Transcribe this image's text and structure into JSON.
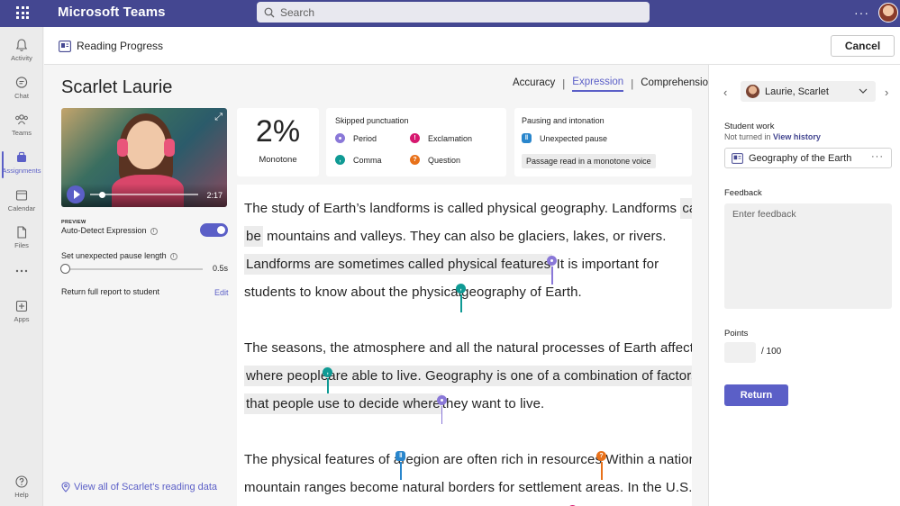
{
  "app": {
    "title": "Microsoft Teams",
    "search_placeholder": "Search",
    "more": "···"
  },
  "rail": [
    {
      "label": "Activity",
      "icon": "bell-icon"
    },
    {
      "label": "Chat",
      "icon": "chat-icon"
    },
    {
      "label": "Teams",
      "icon": "teams-icon"
    },
    {
      "label": "Assignments",
      "icon": "assignments-icon",
      "active": true
    },
    {
      "label": "Calendar",
      "icon": "calendar-icon"
    },
    {
      "label": "Files",
      "icon": "file-icon"
    },
    {
      "label": "",
      "icon": "more-icon"
    },
    {
      "label": "Apps",
      "icon": "apps-icon"
    },
    {
      "label": "Help",
      "icon": "help-icon"
    }
  ],
  "header": {
    "title": "Reading Progress",
    "cancel_label": "Cancel"
  },
  "student": {
    "name": "Scarlet Laurie",
    "video_time": "2:17"
  },
  "settings": {
    "preview_tag": "PREVIEW",
    "auto_detect_label": "Auto-Detect Expression",
    "auto_detect_on": true,
    "pause_length_label": "Set unexpected pause length",
    "pause_length_value": "0.5s",
    "full_report_label": "Return full report to student",
    "edit_label": "Edit",
    "view_all_label": "View all of Scarlet's reading data"
  },
  "tabs": {
    "items": [
      "Accuracy",
      "Expression",
      "Comprehension"
    ],
    "separator": "|",
    "active": "Expression"
  },
  "metrics": {
    "monotone_pct": "2%",
    "monotone_label": "Monotone",
    "skipped_title": "Skipped punctuation",
    "period": "Period",
    "exclamation": "Exclamation",
    "comma": "Comma",
    "question": "Question",
    "pausing_title": "Pausing and intonation",
    "unexpected_pause": "Unexpected pause",
    "monotone_chip": "Passage read in a monotone voice",
    "exclamation_mark": "!",
    "question_mark": "?"
  },
  "passage": {
    "l1a": "The study of Earth’s ",
    "l1b": "landforms",
    "l1c": " is called physical geography. Landforms ",
    "l1d": "can",
    "l2a": "be",
    "l2b": " mountains and valleys. They can also be ",
    "l2c": "glaciers",
    "l2d": ", lakes, or rivers.",
    "l3a": "Landforms are sometimes called physical features",
    "l3b": " It is important for",
    "l4a": "students to know about the physical",
    "l4b": "geography of Earth.",
    "l5a": "The seasons, the ",
    "l5b": "atmosphere",
    "l5c": " and all ",
    "l5d": "the",
    "l5e": " natural processes of Earth affect",
    "l6a": "where people",
    "l6b": "are able to live. Geography is one of a ",
    "l6c": "combination",
    "l6d": " of factors",
    "l7a": "that people use to decide where",
    "l7b": "they want to live.",
    "l8a": "The ",
    "l8b": "physical",
    "l8c": " features of a",
    "l8d": "region are often rich in resources",
    "l8e": " Within a nation,",
    "l9": "mountain ranges become natural borders for settlement areas. In the U.S.,"
  },
  "right": {
    "student_select": "Laurie, Scarlet",
    "student_work_label": "Student work",
    "not_turned_in": "Not turned in",
    "view_history": "View history",
    "work_title": "Geography of the Earth",
    "work_more": "···",
    "feedback_label": "Feedback",
    "feedback_placeholder": "Enter feedback",
    "points_label": "Points",
    "points_max": "/ 100",
    "return_label": "Return"
  },
  "colors": {
    "brand": "#444791",
    "accent": "#5b5fc7",
    "period": "#8a78d8",
    "comma": "#0f9a94",
    "exclamation": "#d6186f",
    "question": "#e8711a",
    "pause": "#2986cc"
  }
}
